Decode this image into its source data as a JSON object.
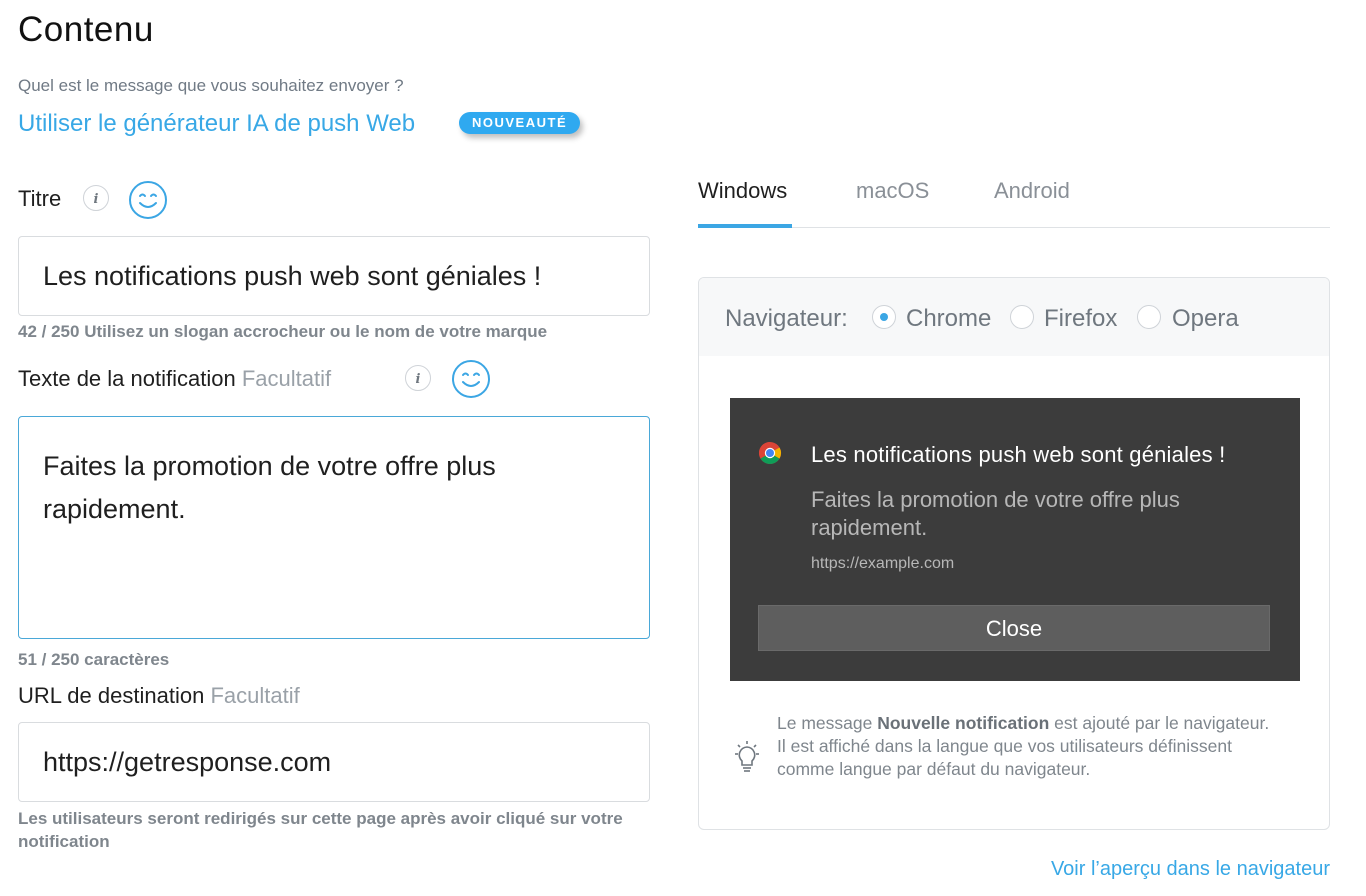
{
  "header": {
    "title": "Contenu",
    "subtitle": "Quel est le message que vous souhaitez envoyer ?",
    "ai_link": "Utiliser le générateur IA de push Web",
    "badge": "NOUVEAUTÉ"
  },
  "form": {
    "title_label": "Titre",
    "title_value": "Les notifications push web sont géniales !",
    "title_counter": "42 / 250",
    "title_hint": "Utilisez un slogan accrocheur ou le nom de votre marque",
    "body_label": "Texte de la notification",
    "optional_label": "Facultatif",
    "body_value": "Faites la promotion de votre offre plus rapidement.",
    "body_counter": "51 / 250 caractères",
    "url_label": "URL de destination",
    "url_value": "https://getresponse.com",
    "url_hint": "Les utilisateurs seront redirigés sur cette page après avoir cliqué sur votre notification"
  },
  "preview": {
    "tabs": [
      {
        "label": "Windows",
        "active": true
      },
      {
        "label": "macOS",
        "active": false
      },
      {
        "label": "Android",
        "active": false
      }
    ],
    "browser_label": "Navigateur:",
    "browsers": [
      {
        "label": "Chrome",
        "selected": true
      },
      {
        "label": "Firefox",
        "selected": false
      },
      {
        "label": "Opera",
        "selected": false
      }
    ],
    "notification": {
      "title": "Les notifications push web sont géniales !",
      "body": "Faites la promotion de votre offre plus rapidement.",
      "url": "https://example.com",
      "close_label": "Close"
    },
    "note": {
      "prefix": "Le message ",
      "bold": "Nouvelle notification",
      "suffix": " est ajouté par le navigateur. Il est affiché dans la langue que vos utilisateurs définissent comme langue par défaut du navigateur."
    },
    "browser_preview_link": "Voir l’aperçu dans le navigateur"
  },
  "colors": {
    "accent": "#3ba6e4",
    "link": "#38a8e6",
    "notification_bg": "#3c3c3c"
  },
  "icons": [
    "info-icon",
    "emoji-smile-icon",
    "chrome-logo-icon",
    "lightbulb-icon"
  ]
}
